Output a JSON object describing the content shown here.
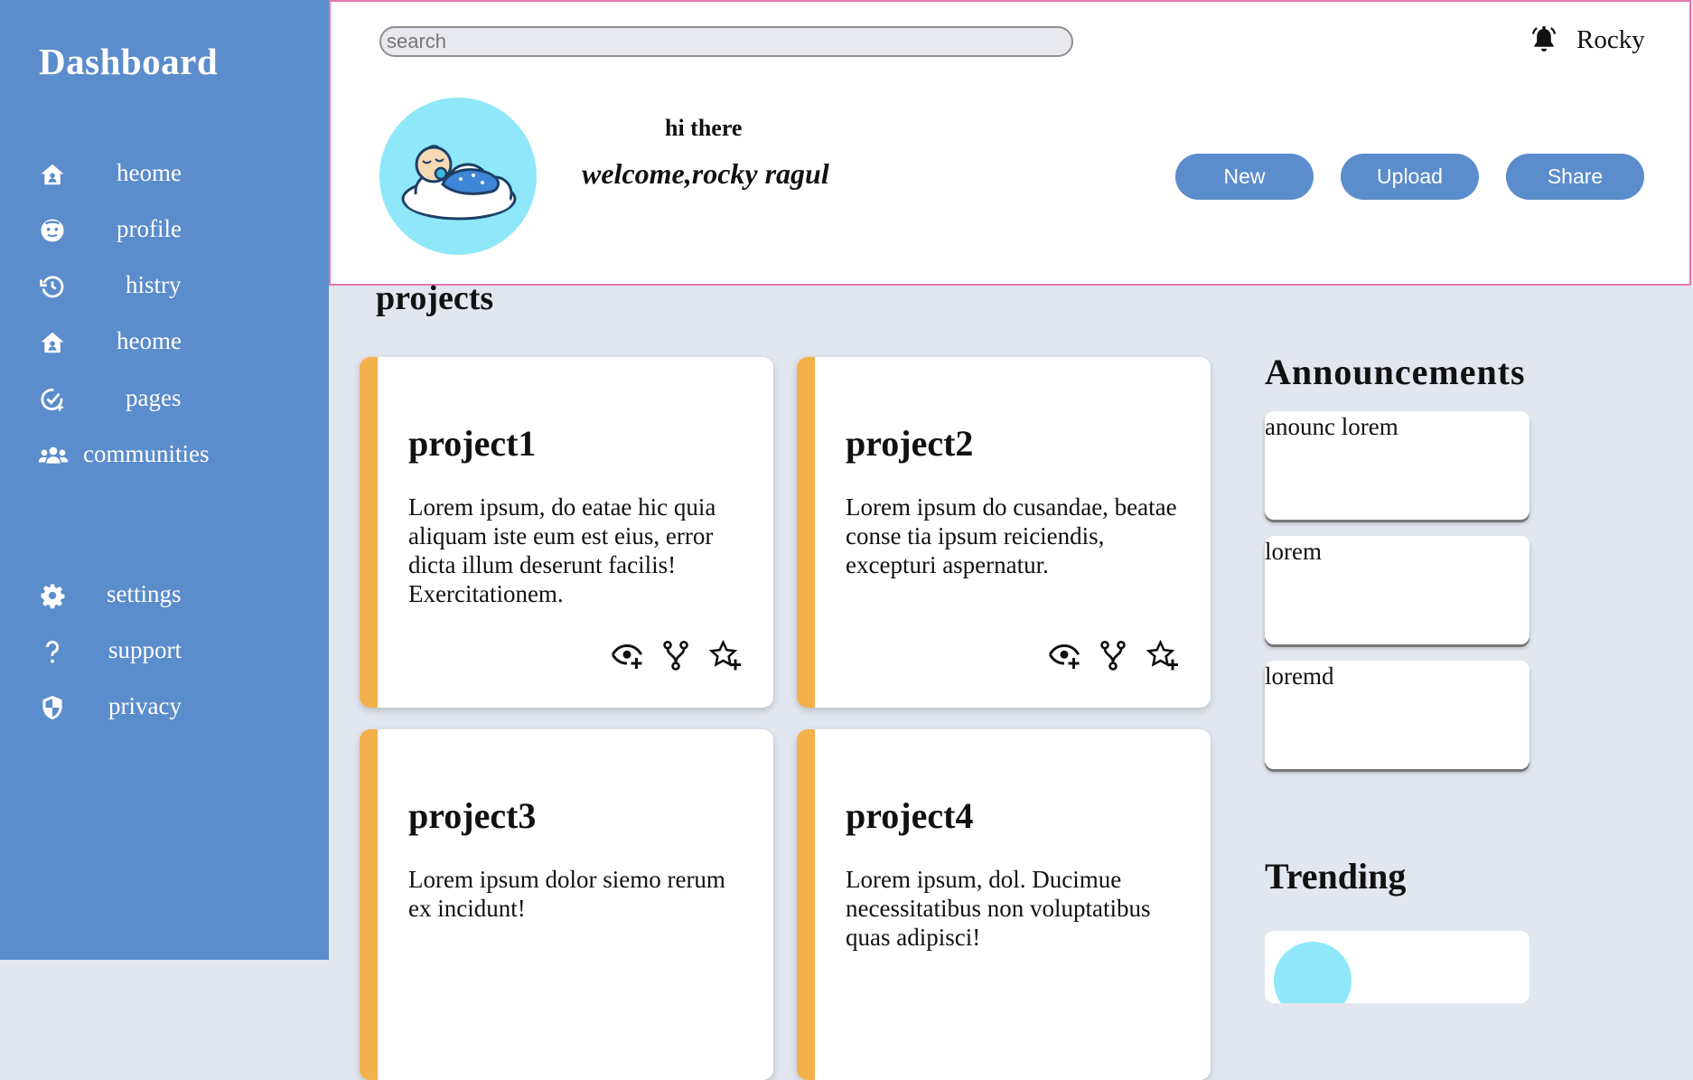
{
  "sidebar": {
    "brand": "Dashboard",
    "items": [
      {
        "label": "heome",
        "icon": "home-icon"
      },
      {
        "label": "profile",
        "icon": "profile-icon"
      },
      {
        "label": "histry",
        "icon": "history-icon"
      },
      {
        "label": "heome",
        "icon": "home-icon"
      },
      {
        "label": "pages",
        "icon": "pages-icon"
      },
      {
        "label": "communities",
        "icon": "communities-icon"
      }
    ],
    "bottom_items": [
      {
        "label": "settings",
        "icon": "gear-icon"
      },
      {
        "label": "support",
        "icon": "question-icon"
      },
      {
        "label": "privacy",
        "icon": "shield-icon"
      }
    ]
  },
  "header": {
    "search_placeholder": "search",
    "username": "Rocky",
    "greeting": "hi there",
    "welcome": "welcome,rocky ragul",
    "buttons": {
      "new": "New",
      "upload": "Upload",
      "share": "Share"
    }
  },
  "projects": {
    "title": "projects",
    "items": [
      {
        "title": "project1",
        "desc": "Lorem ipsum, do eatae hic quia aliquam iste eum est eius, error dicta illum deserunt facilis! Exercitationem."
      },
      {
        "title": "project2",
        "desc": "Lorem ipsum do cusandae, beatae conse tia ipsum reiciendis, excepturi aspernatur."
      },
      {
        "title": "project3",
        "desc": "Lorem ipsum dolor siemo rerum ex incidunt!"
      },
      {
        "title": "project4",
        "desc": "Lorem ipsum, dol. Ducimue necessitatibus non voluptatibus quas adipisci!"
      }
    ]
  },
  "announcements": {
    "title": "Announcements",
    "items": [
      "anounc lorem",
      "lorem",
      "loremd"
    ]
  },
  "trending": {
    "title": "Trending"
  },
  "colors": {
    "sidebar": "#5b8ccb",
    "accent": "#f4b04a",
    "header_border": "#e476ad",
    "avatar_bg": "#8ee8f9",
    "page_bg": "#e2e6ee"
  }
}
